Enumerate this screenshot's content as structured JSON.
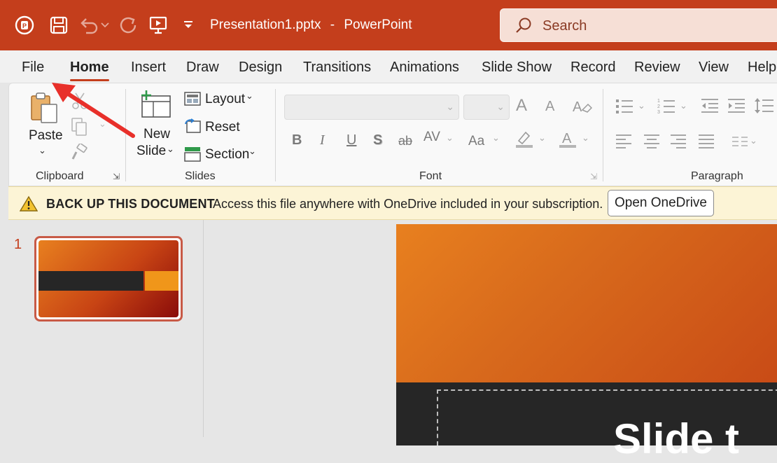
{
  "titlebar": {
    "file_name": "Presentation1.pptx",
    "separator": "-",
    "app_name": "PowerPoint",
    "search_label": "Search"
  },
  "tabs": [
    {
      "label": "File"
    },
    {
      "label": "Home",
      "active": true
    },
    {
      "label": "Insert"
    },
    {
      "label": "Draw"
    },
    {
      "label": "Design"
    },
    {
      "label": "Transitions"
    },
    {
      "label": "Animations"
    },
    {
      "label": "Slide Show"
    },
    {
      "label": "Record"
    },
    {
      "label": "Review"
    },
    {
      "label": "View"
    },
    {
      "label": "Help"
    }
  ],
  "ribbon": {
    "clipboard": {
      "paste_label": "Paste",
      "group_label": "Clipboard"
    },
    "slides": {
      "new_slide_line1": "New",
      "new_slide_line2": "Slide",
      "layout_label": "Layout",
      "reset_label": "Reset",
      "section_label": "Section",
      "group_label": "Slides"
    },
    "font": {
      "group_label": "Font",
      "bold_glyph": "B",
      "italic_glyph": "I",
      "underline_glyph": "U",
      "shadow_glyph": "S",
      "strike_glyph": "ab",
      "spacing_glyph": "AV",
      "case_glyph": "Aa",
      "grow_glyph": "A",
      "shrink_glyph": "A",
      "color_glyph": "A"
    },
    "paragraph": {
      "group_label": "Paragraph"
    }
  },
  "notification": {
    "title": "BACK UP THIS DOCUMENT",
    "message": "Access this file anywhere with OneDrive included in your subscription.",
    "button_label": "Open OneDrive"
  },
  "thumbnails": {
    "slide_number": "1"
  },
  "slide": {
    "title_partial": "Slide t"
  },
  "colors": {
    "accent": "#c43e1c",
    "notification_bg": "#fcf4d6"
  }
}
